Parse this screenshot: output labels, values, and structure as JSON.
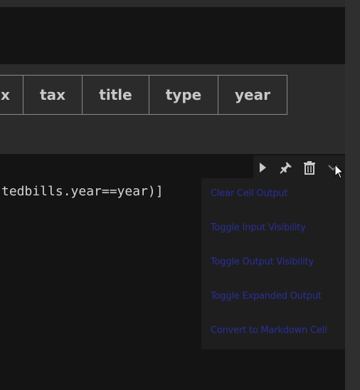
{
  "table": {
    "headers": [
      "x",
      "tax",
      "title",
      "type",
      "year"
    ]
  },
  "code": {
    "line": "tedbills.year==year)]"
  },
  "toolbar": {
    "run_icon": "play-icon",
    "pin_icon": "pin-icon",
    "delete_icon": "trash-icon",
    "more_icon": "chevron-down-icon"
  },
  "menu": {
    "items": [
      "Clear Cell Output",
      "Toggle Input Visibility",
      "Toggle Output Visibility",
      "Toggle Expanded Output",
      "Convert to Markdown Cell"
    ]
  }
}
